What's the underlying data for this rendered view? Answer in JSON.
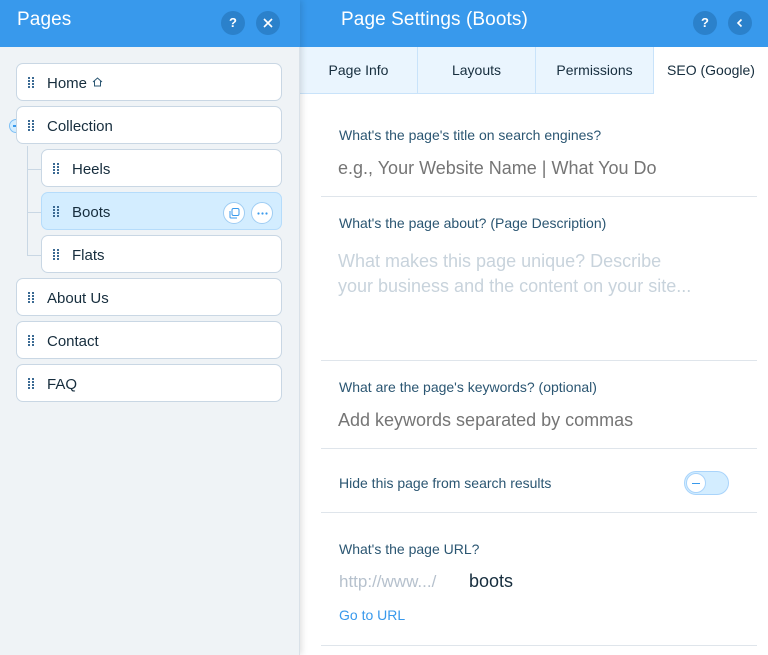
{
  "pages_panel": {
    "title": "Pages",
    "help_label": "?",
    "items": [
      {
        "label": "Home"
      },
      {
        "label": "Collection"
      },
      {
        "label": "Heels"
      },
      {
        "label": "Boots"
      },
      {
        "label": "Flats"
      },
      {
        "label": "About Us"
      },
      {
        "label": "Contact"
      },
      {
        "label": "FAQ"
      }
    ],
    "selected_item": "Boots"
  },
  "settings_panel": {
    "title": "Page Settings (Boots)",
    "help_label": "?",
    "tabs": [
      {
        "label": "Page Info"
      },
      {
        "label": "Layouts"
      },
      {
        "label": "Permissions"
      },
      {
        "label": "SEO (Google)"
      }
    ],
    "active_tab": "SEO (Google)",
    "seo": {
      "title_label": "What's the page's title on search engines?",
      "title_placeholder": "e.g., Your Website Name | What You Do",
      "description_label": "What's the page about? (Page Description)",
      "description_placeholder_line1": "What makes this page unique? Describe",
      "description_placeholder_line2": "your business and the content on your site...",
      "keywords_label": "What are the page's keywords? (optional)",
      "keywords_placeholder": "Add keywords separated by commas",
      "hide_label": "Hide this page from search results",
      "hide_enabled": false,
      "url_label": "What's the page URL?",
      "url_prefix": "http://www.../",
      "url_slug": "boots",
      "goto_label": "Go to URL"
    }
  },
  "colors": {
    "header_blue": "#3899ec",
    "selected_row": "#d3edff",
    "panel_bg": "#eff3f6"
  }
}
